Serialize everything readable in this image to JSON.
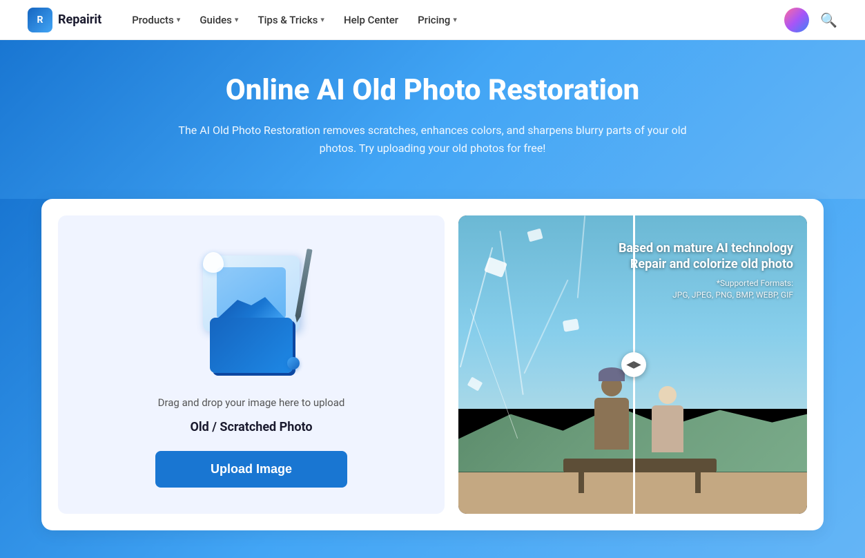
{
  "nav": {
    "logo_text": "Repairit",
    "items": [
      {
        "label": "Products",
        "has_dropdown": true
      },
      {
        "label": "Guides",
        "has_dropdown": true
      },
      {
        "label": "Tips & Tricks",
        "has_dropdown": true
      },
      {
        "label": "Help Center",
        "has_dropdown": false
      },
      {
        "label": "Pricing",
        "has_dropdown": true
      }
    ],
    "search_icon": "🔍"
  },
  "hero": {
    "title": "Online AI Old Photo Restoration",
    "subtitle": "The AI Old Photo Restoration removes scratches, enhances colors, and sharpens blurry parts of your old photos. Try uploading your old photos for free!"
  },
  "upload_panel": {
    "drag_text": "Drag and drop your image here to upload",
    "photo_type": "Old / Scratched Photo",
    "button_label": "Upload Image"
  },
  "preview": {
    "overlay_title_line1": "Based on mature AI technology",
    "overlay_title_line2": "Repair and colorize old photo",
    "formats_label": "*Supported Formats:",
    "formats_value": "JPG, JPEG, PNG, BMP, WEBP, GIF",
    "slider_icon": "◀▶"
  }
}
